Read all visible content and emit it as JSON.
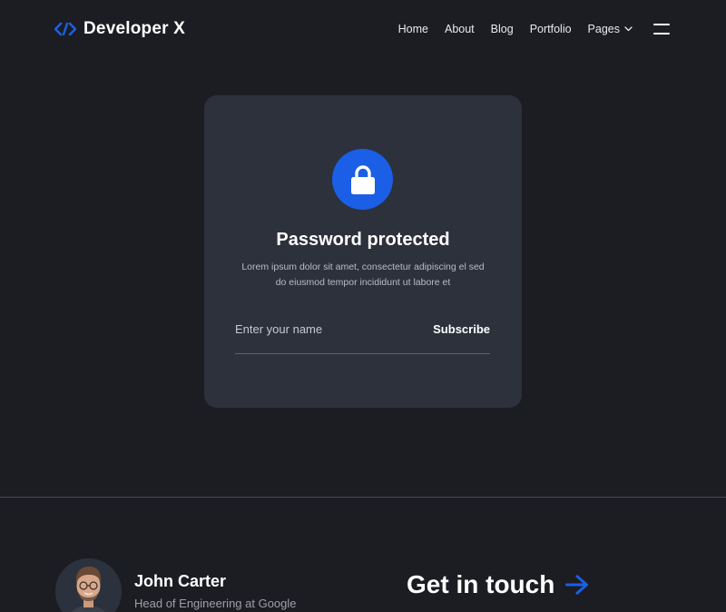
{
  "brand": {
    "name": "Developer X",
    "icon": "code-brackets-icon",
    "accent": "#1a5fe6"
  },
  "nav": {
    "items": [
      {
        "label": "Home"
      },
      {
        "label": "About"
      },
      {
        "label": "Blog"
      },
      {
        "label": "Portfolio"
      },
      {
        "label": "Pages"
      }
    ],
    "pages_icon": "chevron-down-icon",
    "menu_icon": "hamburger-menu-icon"
  },
  "card": {
    "icon": "lock-icon",
    "title": "Password protected",
    "description": "Lorem ipsum dolor sit amet, consectetur adipiscing el sed do eiusmod tempor incididunt ut labore et",
    "input": {
      "placeholder": "Enter your name",
      "value": ""
    },
    "button_label": "Subscribe",
    "background": "#2d313c"
  },
  "footer": {
    "author": {
      "name": "John Carter",
      "role": "Head of Engineering at Google"
    },
    "cta": {
      "label": "Get in touch",
      "icon": "arrow-right-icon"
    }
  },
  "colors": {
    "page_background": "#1b1d22",
    "accent": "#1a5fe6",
    "muted_text": "#9ea1ab"
  }
}
